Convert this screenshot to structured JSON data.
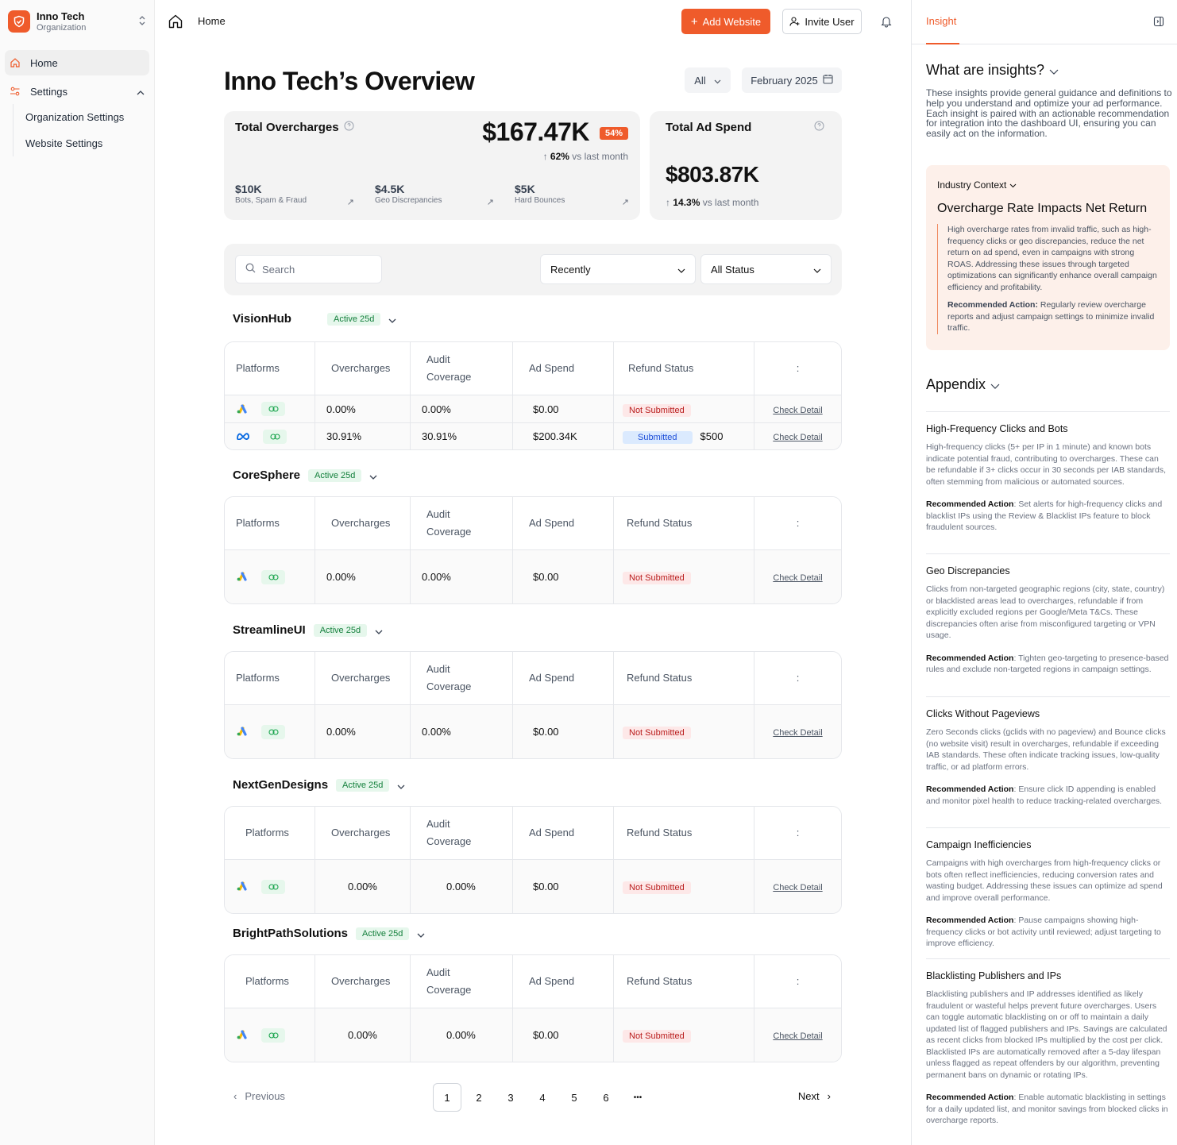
{
  "org": {
    "name": "Inno Tech",
    "subtitle": "Organization"
  },
  "nav": {
    "home": "Home",
    "settings": "Settings",
    "org_settings": "Organization Settings",
    "website_settings": "Website Settings"
  },
  "topbar": {
    "breadcrumb": "Home",
    "add_website": "Add Website",
    "invite_user": "Invite User"
  },
  "overview": {
    "title": "Inno Tech’s Overview",
    "filter_all": "All",
    "date": "February 2025"
  },
  "overcharges": {
    "title": "Total Overcharges",
    "value": "$167.47K",
    "badge": "54%",
    "delta": "62%",
    "delta_suffix": "vs last month",
    "breakdown": [
      {
        "value": "$10K",
        "label": "Bots, Spam & Fraud"
      },
      {
        "value": "$4.5K",
        "label": "Geo Discrepancies"
      },
      {
        "value": "$5K",
        "label": "Hard Bounces"
      }
    ]
  },
  "adspend": {
    "title": "Total Ad Spend",
    "value": "$803.87K",
    "delta": "14.3%",
    "delta_suffix": "vs last month"
  },
  "filters": {
    "search_placeholder": "Search",
    "sort": "Recently",
    "status": "All Status"
  },
  "columns": {
    "platforms": "Platforms",
    "overcharges": "Overcharges",
    "audit": "Audit",
    "coverage": "Coverage",
    "adspend": "Ad Spend",
    "refund": "Refund Status",
    "more": ":"
  },
  "status_labels": {
    "active": "Active 25d",
    "not_submitted": "Not Submitted",
    "submitted": "Submitted",
    "check": "Check Detail"
  },
  "sites": [
    {
      "name": "VisionHub",
      "rows": [
        {
          "platform": "google",
          "overcharges": "0.00%",
          "audit": "0.00%",
          "spend": "$0.00",
          "status": "Not Submitted",
          "amount": ""
        },
        {
          "platform": "meta",
          "overcharges": "30.91%",
          "audit": "30.91%",
          "spend": "$200.34K",
          "status": "Submitted",
          "amount": "$500"
        }
      ]
    },
    {
      "name": "CoreSphere",
      "rows": [
        {
          "platform": "google",
          "overcharges": "0.00%",
          "audit": "0.00%",
          "spend": "$0.00",
          "status": "Not Submitted"
        }
      ]
    },
    {
      "name": "StreamlineUI",
      "rows": [
        {
          "platform": "google",
          "overcharges": "0.00%",
          "audit": "0.00%",
          "spend": "$0.00",
          "status": "Not Submitted"
        }
      ]
    },
    {
      "name": "NextGenDesigns",
      "rows": [
        {
          "platform": "google",
          "overcharges": "0.00%",
          "audit": "0.00%",
          "spend": "$0.00",
          "status": "Not Submitted"
        }
      ]
    },
    {
      "name": "BrightPathSolutions",
      "rows": [
        {
          "platform": "google",
          "overcharges": "0.00%",
          "audit": "0.00%",
          "spend": "$0.00",
          "status": "Not Submitted"
        }
      ]
    }
  ],
  "pagination": {
    "previous": "Previous",
    "next": "Next",
    "pages": [
      "1",
      "2",
      "3",
      "4",
      "5",
      "6",
      "•••"
    ],
    "current": "1"
  },
  "insight": {
    "tab": "Insight",
    "heading": "What are insights?",
    "intro": "These insights provide general guidance and definitions to help you understand and optimize your ad performance. Each insight is paired with an actionable recommendation for integration into the dashboard UI, ensuring you can easily act on the information.",
    "context_label": "Industry Context",
    "context_title": "Overcharge Rate Impacts Net Return",
    "context_body": "High overcharge rates from invalid traffic, such as high-frequency clicks or geo discrepancies, reduce the net return on ad spend, even in campaigns with strong ROAS. Addressing these issues through targeted optimizations can significantly enhance overall campaign efficiency and profitability.",
    "context_ra_label": "Recommended Action:",
    "context_ra": "Regularly review overcharge reports and adjust campaign settings to minimize invalid traffic.",
    "appendix": "Appendix",
    "ra_label": "Recommended Action",
    "sections": [
      {
        "title": "High-Frequency Clicks and Bots",
        "body": "High-frequency clicks (5+ per IP in 1 minute) and known bots indicate potential fraud, contributing to overcharges. These can be refundable if 3+ clicks occur in 30 seconds per IAB standards, often stemming from malicious or automated sources.",
        "action": "Set alerts for high-frequency clicks and blacklist IPs using the Review & Blacklist IPs feature to block fraudulent sources."
      },
      {
        "title": "Geo Discrepancies",
        "body": "Clicks from non-targeted geographic regions (city, state, country) or blacklisted areas lead to overcharges, refundable if from explicitly excluded regions per Google/Meta T&Cs. These discrepancies often arise from misconfigured targeting or VPN usage.",
        "action": "Tighten geo-targeting to presence-based rules and exclude non-targeted regions in campaign settings."
      },
      {
        "title": "Clicks Without Pageviews",
        "body": "Zero Seconds clicks (gclids with no pageview) and Bounce clicks (no website visit) result in overcharges, refundable if exceeding IAB standards. These often indicate tracking issues, low-quality traffic, or ad platform errors.",
        "action": "Ensure click ID appending is enabled and monitor pixel health to reduce tracking-related overcharges."
      },
      {
        "title": "Campaign Inefficiencies",
        "body": "Campaigns with high overcharges from high-frequency clicks or bots often reflect inefficiencies, reducing conversion rates and wasting budget. Addressing these issues can optimize ad spend and improve overall performance.",
        "action": "Pause campaigns showing high-frequency clicks or bot activity until reviewed; adjust targeting to improve efficiency."
      },
      {
        "title": "Blacklisting Publishers and IPs",
        "body": "Blacklisting publishers and IP addresses identified as likely fraudulent or wasteful helps prevent future overcharges. Users can toggle automatic blacklisting on or off to maintain a daily updated list of flagged publishers and IPs. Savings are calculated as recent clicks from blocked IPs multiplied by the cost per click. Blacklisted IPs are automatically removed after a 5-day lifespan unless flagged as repeat offenders by our algorithm, preventing permanent bans on dynamic or rotating IPs.",
        "action": "Enable automatic blacklisting in settings for a daily updated list, and monitor savings from blocked clicks in overcharge reports."
      }
    ]
  },
  "colors": {
    "accent": "#ef5b2b",
    "active_green": "#15803d",
    "not_submitted_red": "#b91c1c",
    "submitted_blue": "#1d4ed8"
  }
}
